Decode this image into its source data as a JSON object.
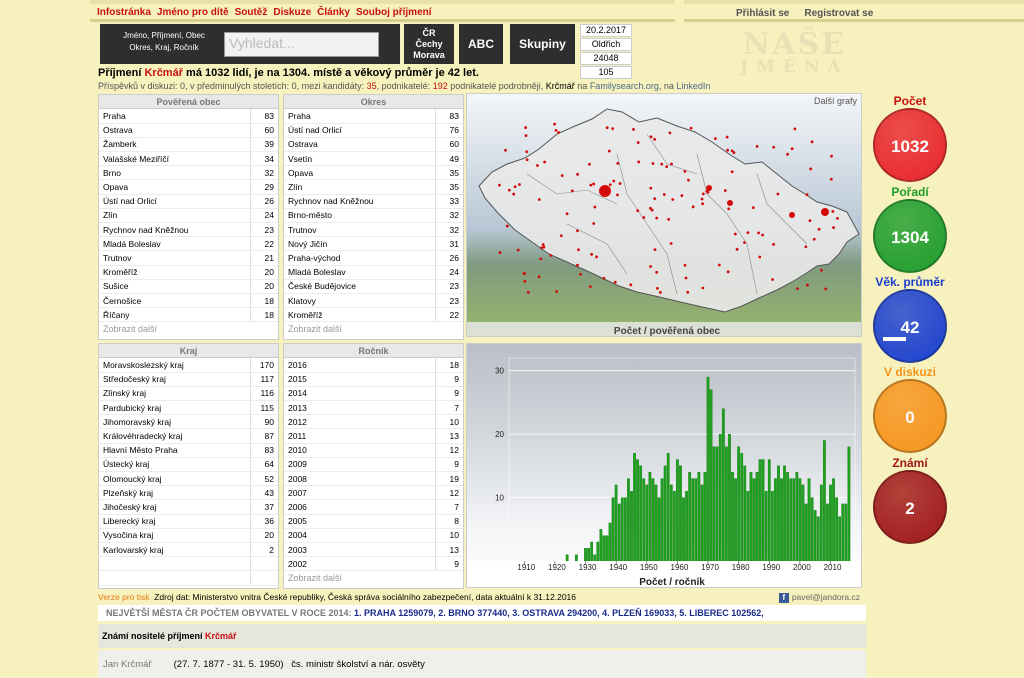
{
  "nav": {
    "items": [
      "Infostránka",
      "Jméno pro dítě",
      "Soutěž",
      "Diskuze",
      "Články",
      "Souboj příjmení"
    ]
  },
  "auth": {
    "login": "Přihlásit se",
    "register": "Registrovat se"
  },
  "search": {
    "label_line1": "Jméno, Příjmení, Obec",
    "label_line2": "Okres, Kraj, Ročník",
    "placeholder": "Vyhledat..."
  },
  "toolbar": {
    "cr_line1": "ČR",
    "cr_line2": "Čechy",
    "cr_line3": "Morava",
    "abc": "ABC",
    "groups": "Skupiny"
  },
  "infobox": {
    "date": "20.2.2017",
    "name": "Oldřich",
    "count1": "24048",
    "count2": "105"
  },
  "logo": {
    "line1": "NAŠE",
    "line2": "JMÉNA"
  },
  "headline": {
    "prefix": "Příjmení ",
    "name": "Krčmář",
    "suffix": " má 1032 lidí, je na 1304. místě a věkový průměr je 42 let."
  },
  "subline": {
    "text1": "Příspěvků v diskuzi: 0, v předminulých stoletích: 0, mezi kandidáty: ",
    "kandidati": "35",
    "text2": ", podnikatelé: ",
    "podnikatele": "192",
    "text3": " podnikatelé podrobněji, ",
    "name": "Krčmář",
    "text4": " na ",
    "fs": "Familysearch.org",
    "text5": ", na ",
    "li": "LinkedIn"
  },
  "panels": {
    "obec": {
      "title": "Pověřená obec",
      "more": "Zobrazit další",
      "rows": [
        [
          "Praha",
          "83"
        ],
        [
          "Ostrava",
          "60"
        ],
        [
          "Žamberk",
          "39"
        ],
        [
          "Valašské Meziříčí",
          "34"
        ],
        [
          "Brno",
          "32"
        ],
        [
          "Opava",
          "29"
        ],
        [
          "Ústí nad Orlicí",
          "26"
        ],
        [
          "Zlín",
          "24"
        ],
        [
          "Rychnov nad Kněžnou",
          "23"
        ],
        [
          "Mladá Boleslav",
          "22"
        ],
        [
          "Trutnov",
          "21"
        ],
        [
          "Kroměříž",
          "20"
        ],
        [
          "Sušice",
          "20"
        ],
        [
          "Černošice",
          "18"
        ],
        [
          "Říčany",
          "18"
        ]
      ]
    },
    "okres": {
      "title": "Okres",
      "more": "Zobrazit další",
      "rows": [
        [
          "Praha",
          "83"
        ],
        [
          "Ústí nad Orlicí",
          "76"
        ],
        [
          "Ostrava",
          "60"
        ],
        [
          "Vsetín",
          "49"
        ],
        [
          "Opava",
          "35"
        ],
        [
          "Zlín",
          "35"
        ],
        [
          "Rychnov nad Kněžnou",
          "33"
        ],
        [
          "Brno-město",
          "32"
        ],
        [
          "Trutnov",
          "32"
        ],
        [
          "Nový Jičín",
          "31"
        ],
        [
          "Praha-východ",
          "26"
        ],
        [
          "Mladá Boleslav",
          "24"
        ],
        [
          "České Budějovice",
          "23"
        ],
        [
          "Klatovy",
          "23"
        ],
        [
          "Kroměříž",
          "22"
        ]
      ]
    },
    "kraj": {
      "title": "Kraj",
      "rows": [
        [
          "Moravskoslezský kraj",
          "170"
        ],
        [
          "Středočeský kraj",
          "117"
        ],
        [
          "Zlínský kraj",
          "116"
        ],
        [
          "Pardubický kraj",
          "115"
        ],
        [
          "Jihomoravský kraj",
          "90"
        ],
        [
          "Královéhradecký kraj",
          "87"
        ],
        [
          "Hlavní Město Praha",
          "83"
        ],
        [
          "Ústecký kraj",
          "64"
        ],
        [
          "Olomoucký kraj",
          "52"
        ],
        [
          "Plzeňský kraj",
          "43"
        ],
        [
          "Jihočeský kraj",
          "37"
        ],
        [
          "Liberecký kraj",
          "36"
        ],
        [
          "Vysočina kraj",
          "20"
        ],
        [
          "Karlovarský kraj",
          "2"
        ],
        [
          "",
          ""
        ],
        [
          "",
          ""
        ]
      ]
    },
    "rocnik": {
      "title": "Ročník",
      "more": "Zobrazit další",
      "rows": [
        [
          "2016",
          "18"
        ],
        [
          "2015",
          "9"
        ],
        [
          "2014",
          "9"
        ],
        [
          "2013",
          "7"
        ],
        [
          "2012",
          "10"
        ],
        [
          "2011",
          "13"
        ],
        [
          "2010",
          "12"
        ],
        [
          "2009",
          "9"
        ],
        [
          "2008",
          "19"
        ],
        [
          "2007",
          "12"
        ],
        [
          "2006",
          "7"
        ],
        [
          "2005",
          "8"
        ],
        [
          "2004",
          "10"
        ],
        [
          "2003",
          "13"
        ],
        [
          "2002",
          "9"
        ]
      ]
    }
  },
  "map": {
    "more_graphs": "Další grafy",
    "caption": "Počet / pověřená obec"
  },
  "chart_data": {
    "type": "bar",
    "title": "",
    "xlabel": "Počet / ročník",
    "ylabel": "",
    "ylim": [
      0,
      32
    ],
    "x_ticks": [
      "1910",
      "1920",
      "1930",
      "1940",
      "1950",
      "1960",
      "1970",
      "1980",
      "1990",
      "2000",
      "2010"
    ],
    "y_ticks": [
      "10",
      "20",
      "30"
    ],
    "color": "#1ea11e",
    "x": [
      1924,
      1927,
      1930,
      1931,
      1932,
      1933,
      1934,
      1935,
      1936,
      1937,
      1938,
      1939,
      1940,
      1941,
      1942,
      1943,
      1944,
      1945,
      1946,
      1947,
      1948,
      1949,
      1950,
      1951,
      1952,
      1953,
      1954,
      1955,
      1956,
      1957,
      1958,
      1959,
      1960,
      1961,
      1962,
      1963,
      1964,
      1965,
      1966,
      1967,
      1968,
      1969,
      1970,
      1971,
      1972,
      1973,
      1974,
      1975,
      1976,
      1977,
      1978,
      1979,
      1980,
      1981,
      1982,
      1983,
      1984,
      1985,
      1986,
      1987,
      1988,
      1989,
      1990,
      1991,
      1992,
      1993,
      1994,
      1995,
      1996,
      1997,
      1998,
      1999,
      2000,
      2001,
      2002,
      2003,
      2004,
      2005,
      2006,
      2007,
      2008,
      2009,
      2010,
      2011,
      2012,
      2013,
      2014,
      2015,
      2016
    ],
    "values": [
      1,
      1,
      2,
      2,
      3,
      1,
      3,
      5,
      4,
      4,
      6,
      10,
      12,
      9,
      10,
      10,
      13,
      11,
      17,
      16,
      15,
      13,
      12,
      14,
      13,
      12,
      10,
      13,
      15,
      17,
      12,
      11,
      16,
      15,
      10,
      11,
      14,
      13,
      13,
      14,
      12,
      14,
      29,
      27,
      18,
      18,
      20,
      24,
      18,
      20,
      14,
      13,
      18,
      17,
      15,
      11,
      14,
      13,
      14,
      16,
      16,
      11,
      16,
      11,
      13,
      15,
      13,
      15,
      14,
      13,
      13,
      14,
      13,
      12,
      9,
      13,
      10,
      8,
      7,
      12,
      19,
      9,
      12,
      13,
      10,
      7,
      9,
      9,
      18
    ]
  },
  "circles": [
    {
      "label": "Počet",
      "value": "1032",
      "color": "#e8242c",
      "label_color": "#c81010"
    },
    {
      "label": "Pořadí",
      "value": "1304",
      "color": "#1d9c2c",
      "label_color": "#1d9c2c"
    },
    {
      "label": "Věk. průměr",
      "value": "42",
      "color": "#1a3fd0",
      "label_color": "#1a3fd0",
      "progress": 0.42
    },
    {
      "label": "V diskuzi",
      "value": "0",
      "color": "#f6931d",
      "label_color": "#f6931d"
    },
    {
      "label": "Známí",
      "value": "2",
      "color": "#a0161a",
      "label_color": "#a0161a"
    }
  ],
  "footer": {
    "print": "Verze pro tisk",
    "source": "Zdroj dat: Ministerstvo vnitra České republiky, Česká správa sociálního zabezpečení, data aktuální k 31.12.2016",
    "email": "pavel@jandora.cz",
    "cities_label": "NEJVĚTŠÍ MĚSTA ČR POČTEM OBYVATEL V ROCE 2014: ",
    "cities": "1. PRAHA 1259079, 2. BRNO 377440, 3. OSTRAVA 294200, 4. PLZEŇ 169033, 5. LIBEREC 102562,"
  },
  "known": {
    "title": "Známí nositelé příjmení ",
    "name": "Krčmář",
    "person": "Jan Krčmář",
    "dates": "(27. 7. 1877 - 31. 5. 1950)",
    "desc": "čs. ministr školství a nár. osvěty"
  }
}
